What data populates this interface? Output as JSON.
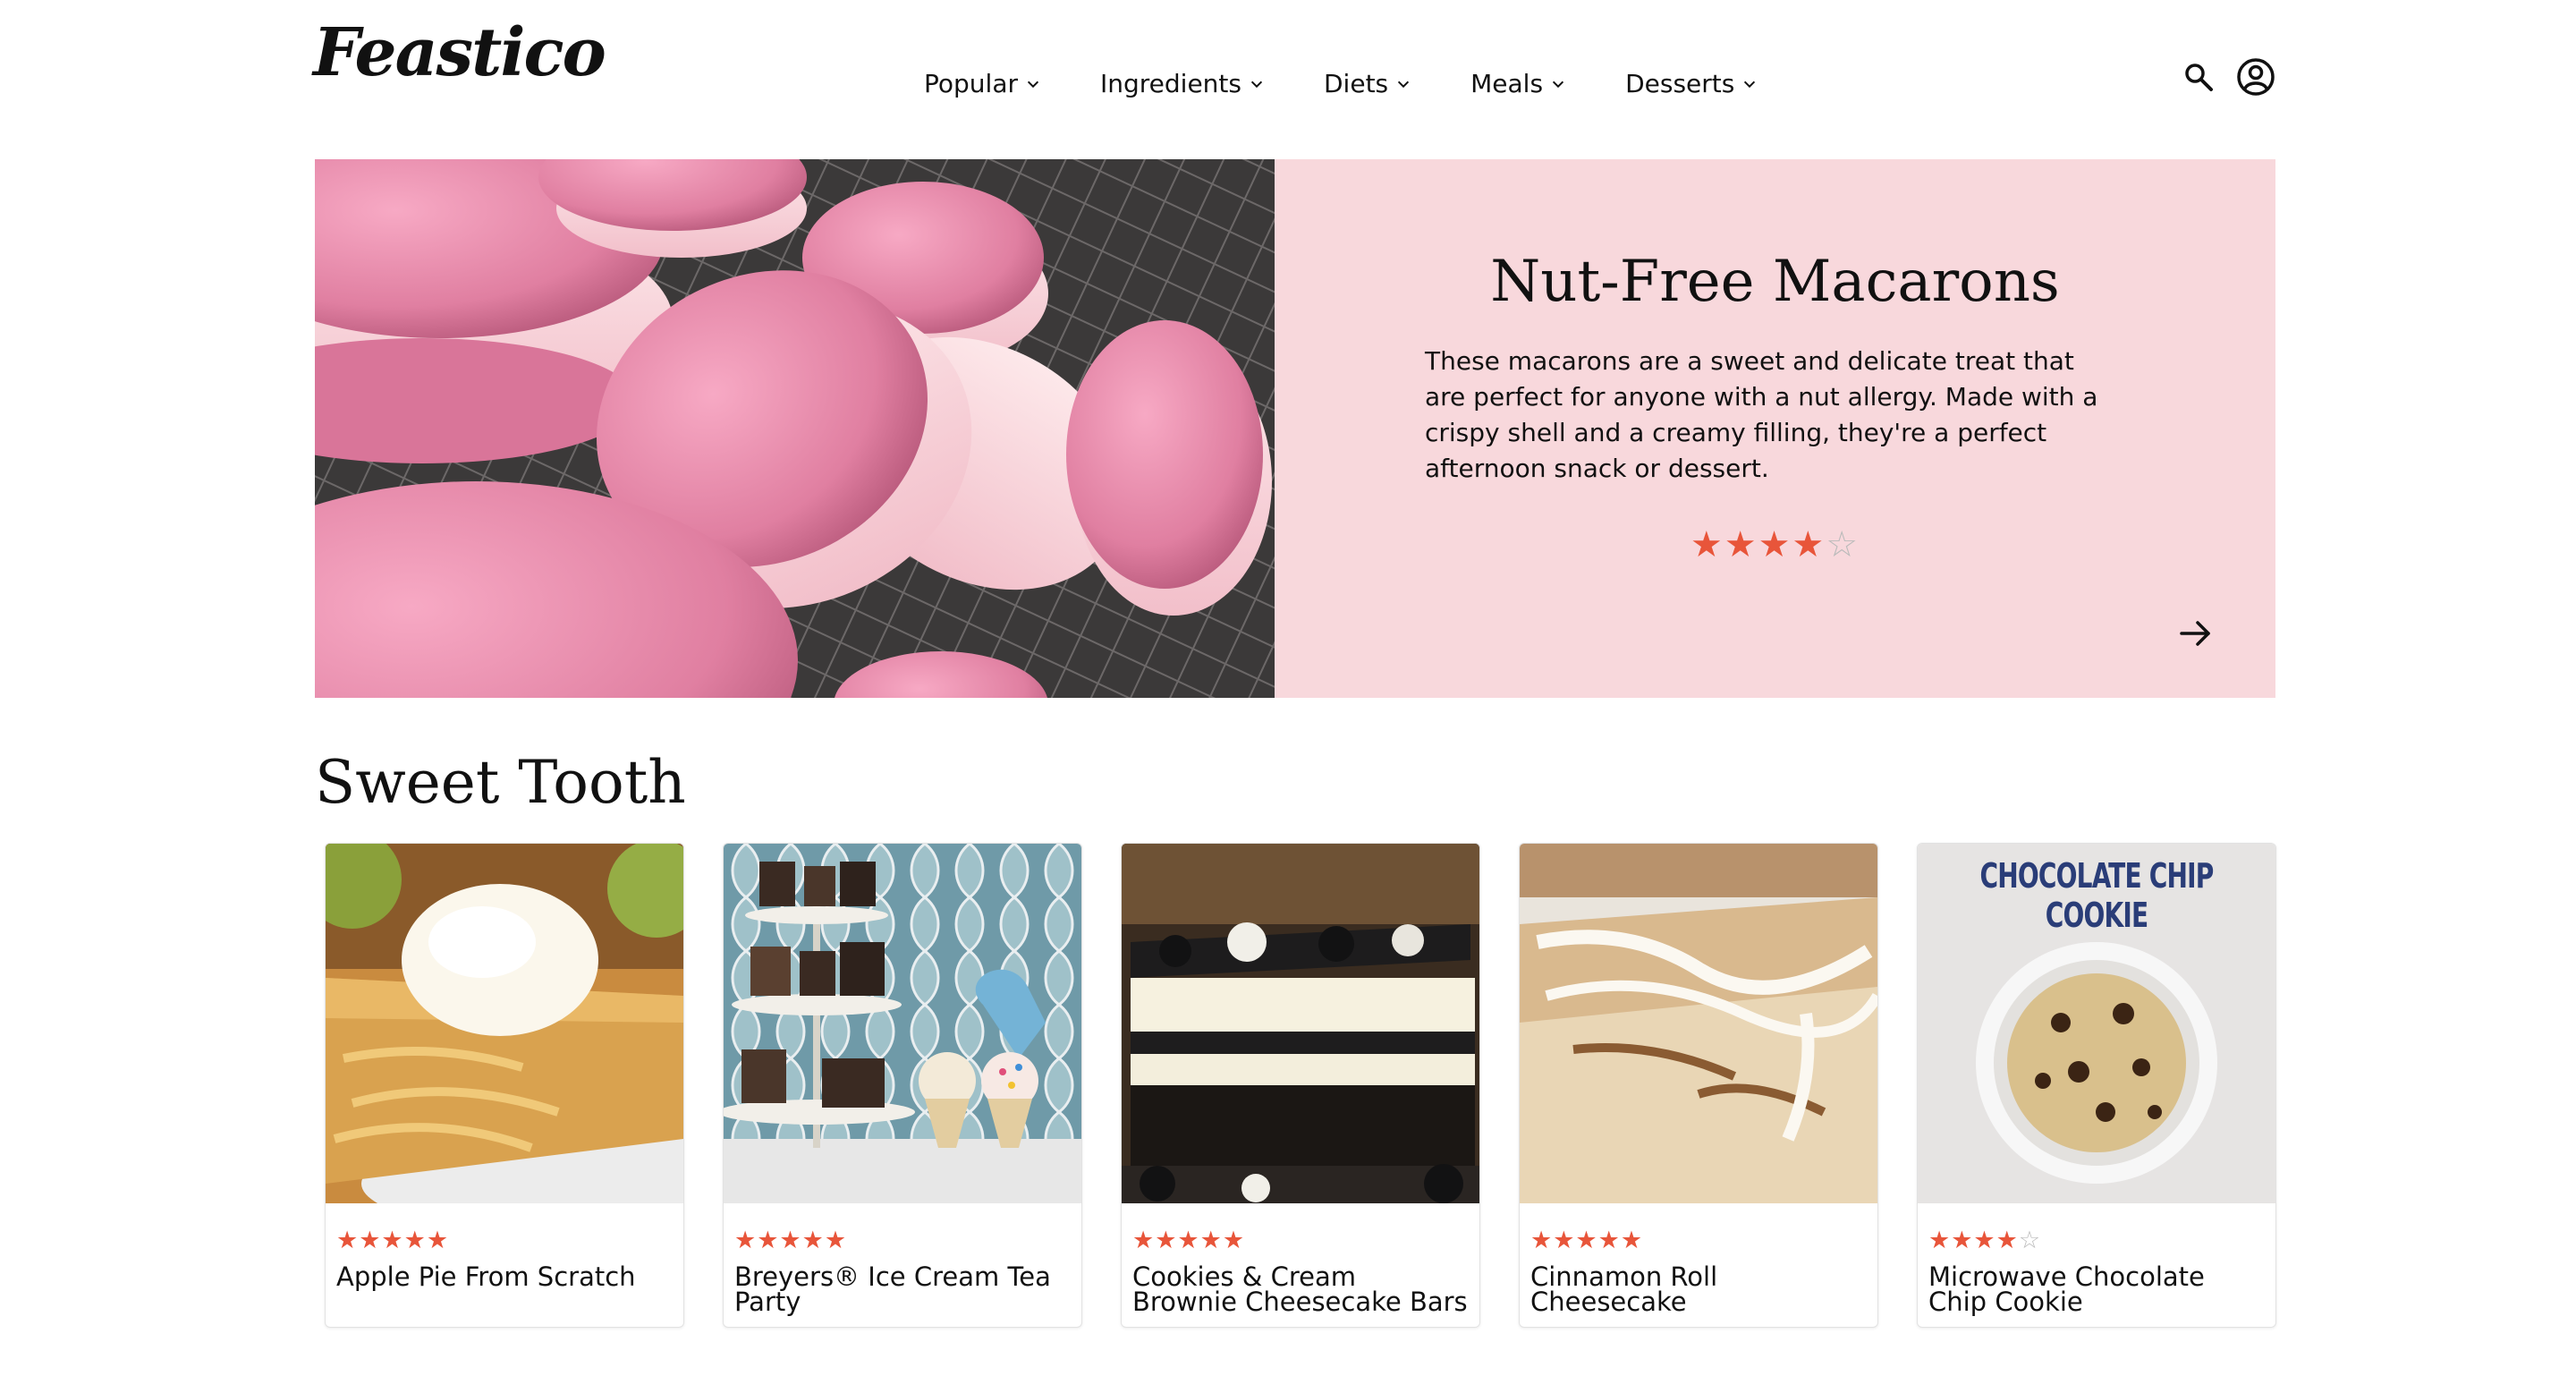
{
  "brand": {
    "logo_text": "Feastico"
  },
  "nav": {
    "items": [
      {
        "label": "Popular"
      },
      {
        "label": "Ingredients"
      },
      {
        "label": "Diets"
      },
      {
        "label": "Meals"
      },
      {
        "label": "Desserts"
      }
    ]
  },
  "header_icons": {
    "search": "search-icon",
    "account": "account-circle-icon"
  },
  "hero": {
    "title": "Nut-Free Macarons",
    "description": "These macarons are a sweet and delicate treat that are perfect for anyone with a nut allergy. Made with a crispy shell and a creamy filling, they're a perfect afternoon snack or dessert.",
    "rating": 4,
    "rating_max": 5,
    "background_color": "#f8d8dc",
    "arrow_icon": "arrow-right-icon"
  },
  "section": {
    "title": "Sweet Tooth",
    "cards": [
      {
        "title": "Apple Pie From Scratch",
        "rating": 5
      },
      {
        "title": "Breyers® Ice Cream Tea Party",
        "rating": 5
      },
      {
        "title": "Cookies & Cream Brownie Cheesecake Bars",
        "rating": 5
      },
      {
        "title": "Cinnamon Roll Cheesecake",
        "rating": 5
      },
      {
        "title": "Microwave Chocolate Chip Cookie",
        "rating": 4,
        "image_text": "CHOCOLATE CHIP COOKIE"
      }
    ]
  },
  "colors": {
    "star": "#e8553a",
    "star_empty": "#bbbbbb",
    "hero_panel": "#f8d8dc"
  }
}
